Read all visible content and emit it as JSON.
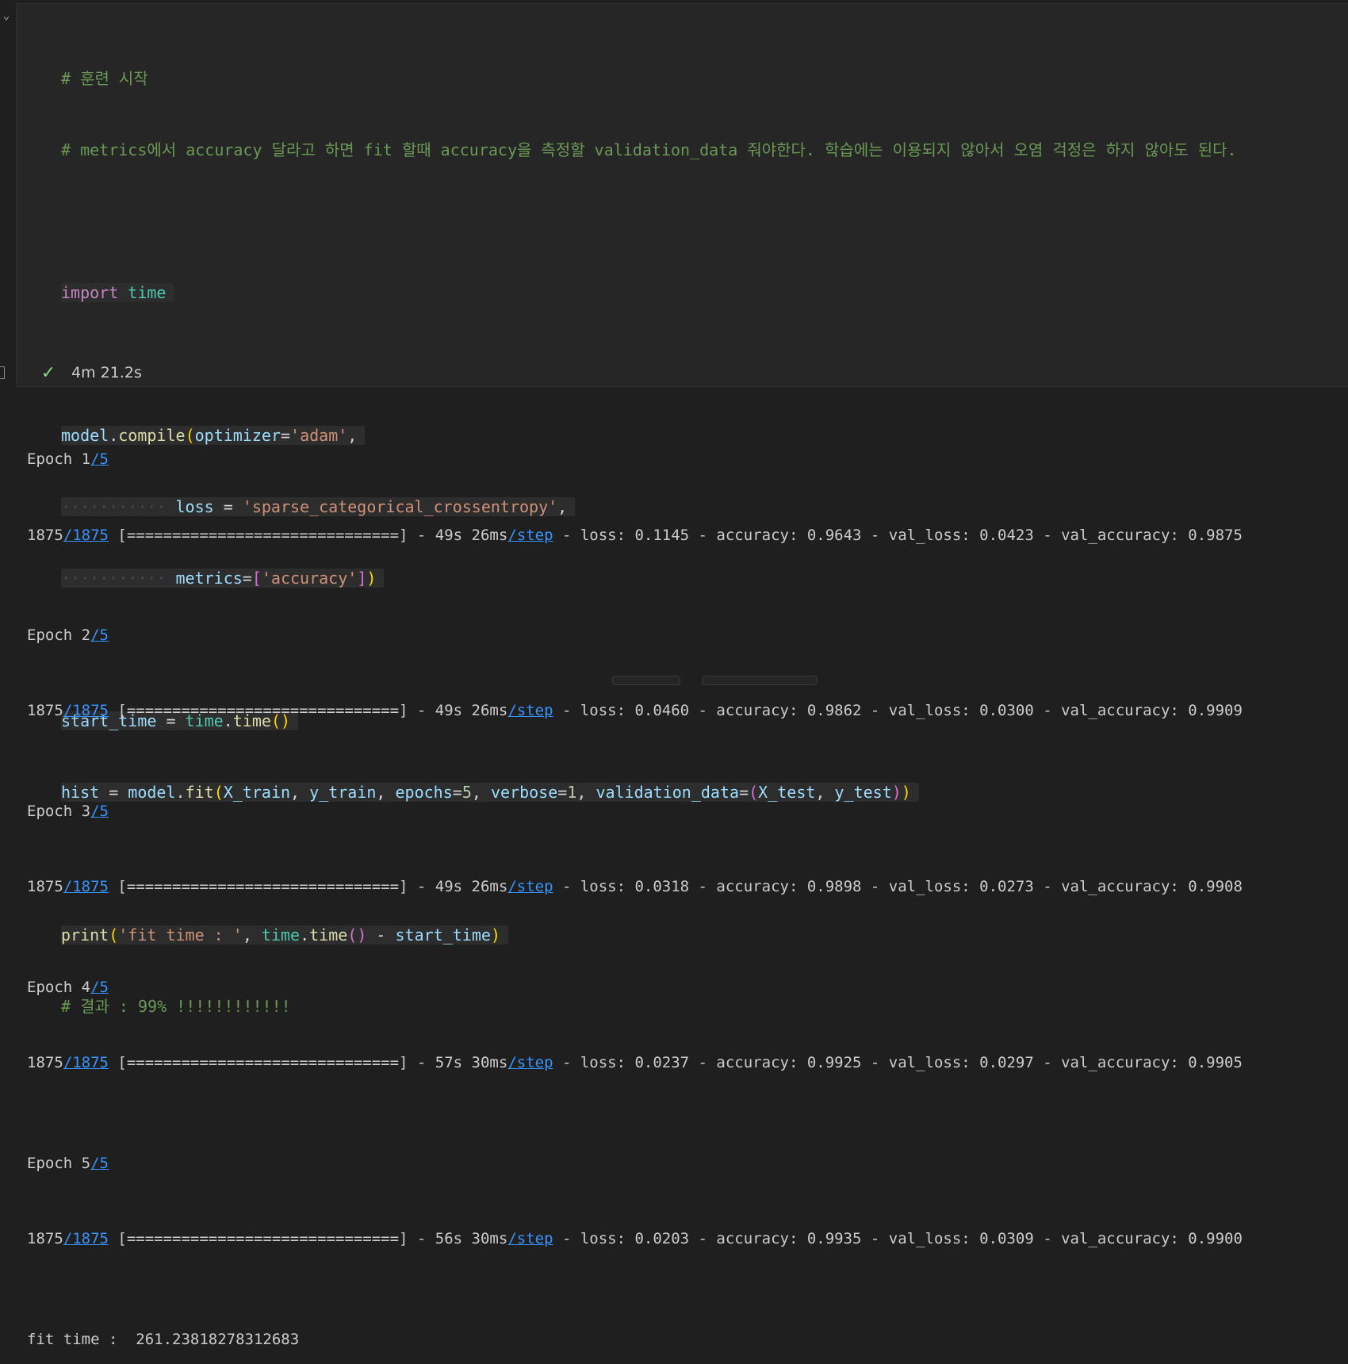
{
  "cell": {
    "comment_line1": "# 훈련 시작",
    "comment_line2": "# metrics에서 accuracy 달라고 하면 fit 할때 accuracy을 측정할 validation_data 줘야한다. 학습에는 이용되지 않아서 오염 걱정은 하지 않아도 된다.",
    "import_keyword": "import",
    "import_module": "time",
    "model_var": "model",
    "compile_fn": "compile",
    "optimizer_param": "optimizer",
    "optimizer_value": "'adam'",
    "loss_param": "loss",
    "loss_value": "'sparse_categorical_crossentropy'",
    "metrics_param": "metrics",
    "metrics_value": "'accuracy'",
    "start_time_var": "start_time",
    "time_module": "time",
    "time_fn": "time",
    "hist_var": "hist",
    "fit_fn": "fit",
    "x_train": "X_train",
    "y_train": "y_train",
    "epochs_param": "epochs",
    "epochs_value": "5",
    "verbose_param": "verbose",
    "verbose_value": "1",
    "validation_param": "validation_data",
    "x_test": "X_test",
    "y_test": "y_test",
    "print_fn": "print",
    "print_str": "'fit time : '",
    "result_comment": "# 결과 : 99% !!!!!!!!!!!!"
  },
  "execution": {
    "status": "success",
    "duration": "4m 21.2s"
  },
  "output": {
    "epochs": [
      {
        "label": "Epoch 1",
        "total": "/5",
        "steps": "1875",
        "steps_total": "/1875",
        "bar": "[==============================]",
        "time": "- 49s 26ms",
        "step_link": "/step",
        "metrics": "- loss: 0.1145 - accuracy: 0.9643 - val_loss: 0.0423 - val_accuracy: 0.9875"
      },
      {
        "label": "Epoch 2",
        "total": "/5",
        "steps": "1875",
        "steps_total": "/1875",
        "bar": "[==============================]",
        "time": "- 49s 26ms",
        "step_link": "/step",
        "metrics": "- loss: 0.0460 - accuracy: 0.9862 - val_loss: 0.0300 - val_accuracy: 0.9909"
      },
      {
        "label": "Epoch 3",
        "total": "/5",
        "steps": "1875",
        "steps_total": "/1875",
        "bar": "[==============================]",
        "time": "- 49s 26ms",
        "step_link": "/step",
        "metrics": "- loss: 0.0318 - accuracy: 0.9898 - val_loss: 0.0273 - val_accuracy: 0.9908"
      },
      {
        "label": "Epoch 4",
        "total": "/5",
        "steps": "1875",
        "steps_total": "/1875",
        "bar": "[==============================]",
        "time": "- 57s 30ms",
        "step_link": "/step",
        "metrics": "- loss: 0.0237 - accuracy: 0.9925 - val_loss: 0.0297 - val_accuracy: 0.9905"
      },
      {
        "label": "Epoch 5",
        "total": "/5",
        "steps": "1875",
        "steps_total": "/1875",
        "bar": "[==============================]",
        "time": "- 56s 30ms",
        "step_link": "/step",
        "metrics": "- loss: 0.0203 - accuracy: 0.9935 - val_loss: 0.0309 - val_accuracy: 0.9900"
      }
    ],
    "fit_time_label": "fit time :  ",
    "fit_time_value": "261.23818278312683"
  },
  "icons": {
    "collapse": "chevron-down-icon",
    "status": "check-icon"
  },
  "colors": {
    "background": "#1f1f1f",
    "cell_background": "#262626",
    "comment": "#6a9955",
    "string": "#ce9178",
    "link": "#3794ff",
    "success": "#89d185"
  }
}
